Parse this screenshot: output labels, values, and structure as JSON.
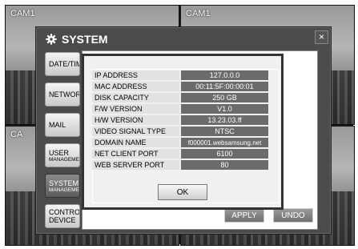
{
  "cameras": [
    "CAM1",
    "CAM1",
    "CA"
  ],
  "window": {
    "title": "SYSTEM",
    "close": "×"
  },
  "sidebar": [
    {
      "line1": "DATE/TIM",
      "line2": ""
    },
    {
      "line1": "NETWOR",
      "line2": ""
    },
    {
      "line1": "MAIL",
      "line2": ""
    },
    {
      "line1": "USER",
      "line2": "MANAGEMEN"
    },
    {
      "line1": "SYSTEM",
      "line2": "MANAGEMEN"
    },
    {
      "line1": "CONTROL",
      "line2": "DEVICE"
    }
  ],
  "buttons": {
    "apply": "APPLY",
    "undo": "UNDO",
    "ok": "OK"
  },
  "info": [
    {
      "label": "IP ADDRESS",
      "value": "127.0.0.0"
    },
    {
      "label": "MAC ADDRESS",
      "value": "00:11:5F:00:00:01"
    },
    {
      "label": "DISK CAPACITY",
      "value": "250 GB"
    },
    {
      "label": "F/W VERSION",
      "value": "V1.0"
    },
    {
      "label": "H/W VERSION",
      "value": "13.23.03.ff"
    },
    {
      "label": "VIDEO SIGNAL TYPE",
      "value": "NTSC"
    },
    {
      "label": "DOMAIN NAME",
      "value": "f000001.websamsung.net"
    },
    {
      "label": "NET CLIENT PORT",
      "value": "6100"
    },
    {
      "label": "WEB SERVER PORT",
      "value": "80"
    }
  ]
}
